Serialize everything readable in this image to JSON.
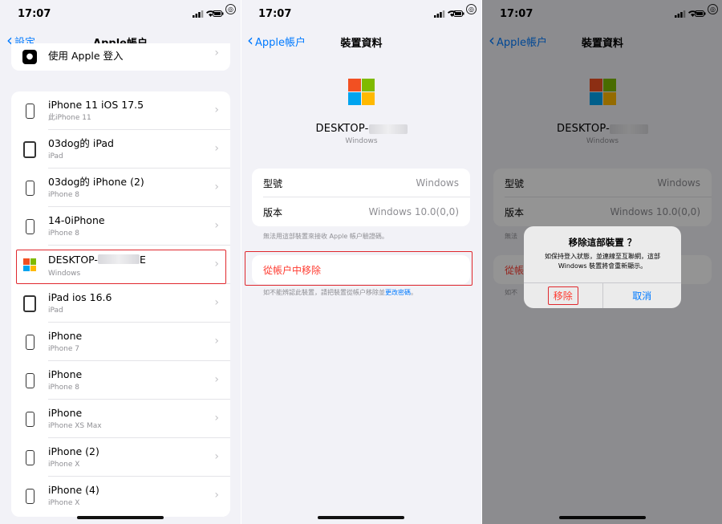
{
  "status": {
    "time": "17:07"
  },
  "colors": {
    "accent": "#007aff",
    "destructive": "#ff3b30",
    "highlight": "#e0282e",
    "ms_red": "#f25022",
    "ms_green": "#7fba00",
    "ms_blue": "#00a4ef",
    "ms_yellow": "#ffb900"
  },
  "panel1": {
    "back": "設定",
    "title": "Apple帳户",
    "top_item": "使用 Apple 登入",
    "devices": [
      {
        "name": "iPhone 11 iOS 17.5",
        "sub": "此iPhone 11",
        "icon": "iphone-icon"
      },
      {
        "name": "03dog的 iPad",
        "sub": "iPad",
        "icon": "ipad-icon"
      },
      {
        "name": "03dog的 iPhone (2)",
        "sub": "iPhone 8",
        "icon": "iphone-icon"
      },
      {
        "name": "14-0iPhone",
        "sub": "iPhone 8",
        "icon": "iphone-icon"
      },
      {
        "name": "DESKTOP-",
        "suffix": "E",
        "sub": "Windows",
        "icon": "windows-icon"
      },
      {
        "name": "iPad ios 16.6",
        "sub": "iPad",
        "icon": "ipad-icon"
      },
      {
        "name": "iPhone",
        "sub": "iPhone 7",
        "icon": "iphone-icon"
      },
      {
        "name": "iPhone",
        "sub": "iPhone 8",
        "icon": "iphone-icon"
      },
      {
        "name": "iPhone",
        "sub": "iPhone XS Max",
        "icon": "iphone-icon"
      },
      {
        "name": "iPhone (2)",
        "sub": "iPhone X",
        "icon": "iphone-icon"
      },
      {
        "name": "iPhone (4)",
        "sub": "iPhone X",
        "icon": "iphone-icon"
      }
    ]
  },
  "panel2": {
    "back": "Apple帳户",
    "title": "裝置資料",
    "device_name": "DESKTOP-",
    "device_sub": "Windows",
    "rows": [
      {
        "label": "型號",
        "value": "Windows"
      },
      {
        "label": "版本",
        "value": "Windows 10.0(0,0)"
      }
    ],
    "note1": "無法用這部裝置來接收 Apple 帳户驗證碼。",
    "remove_label": "從帳户中移除",
    "note2_prefix": "如不能辨認此裝置，請把裝置從帳户移除並",
    "note2_link": "更改密碼",
    "note2_suffix": "。"
  },
  "panel3": {
    "back": "Apple帳户",
    "title": "裝置資料",
    "device_name": "DESKTOP-",
    "device_sub": "Windows",
    "rows": [
      {
        "label": "型號",
        "value": "Windows"
      },
      {
        "label": "版本",
        "value": "Windows 10.0(0,0)"
      }
    ],
    "note1_partial": "無法",
    "remove_partial": "從帳",
    "note2_partial": "如不",
    "alert": {
      "title": "移除這部裝置 ？",
      "message": "如保持登入狀態，並連線至互聯網，這部 Windows 裝置將會重新顯示。",
      "remove_button": "移除",
      "cancel_button": "取消"
    }
  }
}
